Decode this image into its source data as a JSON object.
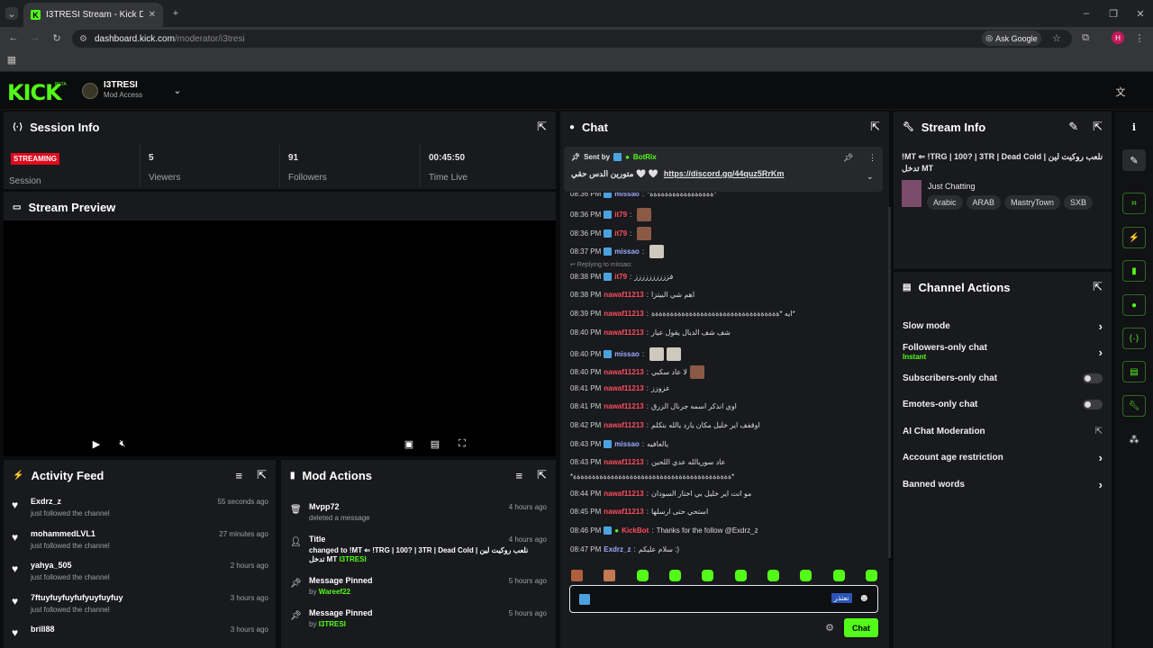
{
  "browser": {
    "tab_title": "I3TRESI Stream - Kick Dashboard",
    "url_host": "dashboard.kick.com",
    "url_path": "/moderator/i3tresi",
    "ask_google": "Ask Google",
    "profile_initial": "H"
  },
  "topnav": {
    "logo": "KICK",
    "logo_beta": "BETA",
    "channel_name": "I3TRESI",
    "channel_role": "Mod Access"
  },
  "session": {
    "title": "Session Info",
    "status": "STREAMING",
    "status_label": "Session",
    "viewers": "5",
    "viewers_label": "Viewers",
    "followers": "91",
    "followers_label": "Followers",
    "time_live": "00:45:50",
    "time_label": "Time Live"
  },
  "preview": {
    "title": "Stream Preview"
  },
  "activity": {
    "title": "Activity Feed",
    "items": [
      {
        "name": "Exdrz_z",
        "desc": "just followed the channel",
        "time": "55 seconds ago"
      },
      {
        "name": "mohammedLVL1",
        "desc": "just followed the channel",
        "time": "27 minutes ago"
      },
      {
        "name": "yahya_505",
        "desc": "just followed the channel",
        "time": "2 hours ago"
      },
      {
        "name": "7ftuyfuyfuyfufyuyfuyfuy",
        "desc": "just followed the channel",
        "time": "3 hours ago"
      },
      {
        "name": "brill88",
        "desc": "",
        "time": "3 hours ago"
      }
    ]
  },
  "modactions": {
    "title": "Mod Actions",
    "items": [
      {
        "name": "Mvpp72",
        "desc": "deleted a message",
        "time": "4 hours ago"
      },
      {
        "name": "Title",
        "desc": "changed to !MT ⇐ !TRG | 100? | 3TR | Dead Cold | نلعب روكيت لين تدخل MT",
        "by": "I3TRESI",
        "time": "4 hours ago"
      },
      {
        "name": "Message Pinned",
        "desc": "by",
        "by": "Wareef22",
        "time": "5 hours ago"
      },
      {
        "name": "Message Pinned",
        "desc": "by",
        "by": "I3TRESI",
        "time": "5 hours ago"
      }
    ]
  },
  "chat": {
    "title": "Chat",
    "pinned": {
      "sent_by": "Sent by",
      "bot": "BotRix",
      "text": "متورين الدس حقي 🤍 🤍",
      "link": "https://discord.gg/44quz5RrKm"
    },
    "messages": [
      {
        "time": "08:36 PM",
        "user": "missao",
        "text": "*ةةةةةةةةةةةةةةةةة*",
        "color": "blue"
      },
      {
        "time": "08:36 PM",
        "user": "it79",
        "text": "",
        "color": "red",
        "emotes": 1
      },
      {
        "time": "08:36 PM",
        "user": "it79",
        "text": "",
        "color": "red",
        "emotes": 1
      },
      {
        "time": "08:37 PM",
        "user": "missao",
        "text": "",
        "color": "blue",
        "emotes": 1
      },
      {
        "time": "08:38 PM",
        "user": "it79",
        "text": "فزززززززززز",
        "color": "red",
        "reply": "Replying to missao:"
      },
      {
        "time": "08:38 PM",
        "user": "nawaf11213",
        "text": "اهم شي البيتزا",
        "color": "red"
      },
      {
        "time": "08:39 PM",
        "user": "nawaf11213",
        "text": "ايه *ةةةةةةةةةةةةةةةةةةةةةةةةةةةةةةةةةة*",
        "color": "red"
      },
      {
        "time": "08:40 PM",
        "user": "nawaf11213",
        "text": "شف شف الدبال يقول عيار",
        "color": "red"
      },
      {
        "time": "08:40 PM",
        "user": "missao",
        "text": "",
        "color": "blue",
        "emotes": 2
      },
      {
        "time": "08:40 PM",
        "user": "nawaf11213",
        "text": "لا عاد سكبي",
        "color": "red",
        "emotes": 1
      },
      {
        "time": "08:41 PM",
        "user": "nawaf11213",
        "text": "عزوزز",
        "color": "red"
      },
      {
        "time": "08:41 PM",
        "user": "nawaf11213",
        "text": "اوي انذكر اسمه جرنال الزرق",
        "color": "red"
      },
      {
        "time": "08:42 PM",
        "user": "nawaf11213",
        "text": "اوقفف اير خليل مكان يارد يالله بتكلم",
        "color": "red"
      },
      {
        "time": "08:43 PM",
        "user": "missao",
        "text": "يالعافيه",
        "color": "blue"
      },
      {
        "time": "08:43 PM",
        "user": "nawaf11213",
        "text": "عاد سوريالله عدي اللحين",
        "color": "red"
      },
      {
        "time": "08:44 PM",
        "user": "nawaf11213",
        "text": "مو انت اير خليل بي اختار السودان",
        "color": "red"
      },
      {
        "time": "08:45 PM",
        "user": "nawaf11213",
        "text": "استحي حتى ارسلها",
        "color": "red"
      },
      {
        "time": "08:46 PM",
        "user": "KickBot",
        "text": "Thanks for the follow @Exdrz_z",
        "color": "red"
      },
      {
        "time": "08:47 PM",
        "user": "Exdrz_z",
        "text": "سلام عليكم :)",
        "color": "blue"
      }
    ],
    "wrap_line": "*ةةةةةةةةةةةةةةةةةةةةةةةةةةةةةةةةةةةةةةةةةة*",
    "input_tag": "نعتذر",
    "send": "Chat"
  },
  "streaminfo": {
    "title": "Stream Info",
    "stream_title": "!MT ⇐ !TRG | 100? | 3TR | Dead Cold | نلعب روكيت لين تدخل MT",
    "category": "Just Chatting",
    "tags": [
      "Arabic",
      "ARAB",
      "MastryTown",
      "SXB"
    ]
  },
  "channelactions": {
    "title": "Channel Actions",
    "items": [
      {
        "label": "Slow mode",
        "type": "arrow"
      },
      {
        "label": "Followers-only chat",
        "sub": "Instant",
        "type": "arrow"
      },
      {
        "label": "Subscribers-only chat",
        "type": "toggle"
      },
      {
        "label": "Emotes-only chat",
        "type": "toggle"
      },
      {
        "label": "AI Chat Moderation",
        "type": "external"
      },
      {
        "label": "Account age restriction",
        "type": "arrow"
      },
      {
        "label": "Banned words",
        "type": "arrow"
      }
    ]
  }
}
